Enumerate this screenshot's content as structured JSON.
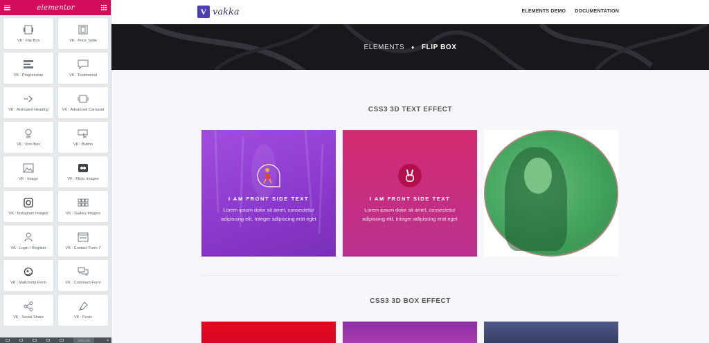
{
  "sidebar": {
    "logo": "elementor",
    "widgets": [
      {
        "label": "VK : Flip Box",
        "icon": "flip-box-icon"
      },
      {
        "label": "VK : Price Table",
        "icon": "price-table-icon"
      },
      {
        "label": "VK : Progressbar",
        "icon": "progressbar-icon"
      },
      {
        "label": "VK : Testimonial",
        "icon": "testimonial-icon"
      },
      {
        "label": "VK : Animated Heading",
        "icon": "animated-heading-icon"
      },
      {
        "label": "VK : Advanced Carousel",
        "icon": "carousel-icon"
      },
      {
        "label": "VK : Icon Box",
        "icon": "icon-box-icon"
      },
      {
        "label": "VK : Button",
        "icon": "button-icon"
      },
      {
        "label": "VK : Image",
        "icon": "image-icon"
      },
      {
        "label": "VK : Flickr Images",
        "icon": "flickr-icon"
      },
      {
        "label": "VK : Instagram Images",
        "icon": "instagram-icon"
      },
      {
        "label": "VK : Gallery Images",
        "icon": "gallery-icon"
      },
      {
        "label": "VK : Login / Register",
        "icon": "login-icon"
      },
      {
        "label": "VK : Contact Form 7",
        "icon": "contact-form-icon"
      },
      {
        "label": "VK : Mailchimp Form",
        "icon": "mailchimp-icon"
      },
      {
        "label": "VK : Comment Form",
        "icon": "comment-form-icon"
      },
      {
        "label": "VK : Social Share",
        "icon": "share-icon"
      },
      {
        "label": "VK : Posts",
        "icon": "posts-icon"
      }
    ],
    "footer": {
      "update_label": "UPDATE"
    }
  },
  "site": {
    "brand": "vakka",
    "brand_mark": "V",
    "nav": [
      "ELEMENTS DEMO",
      "DOCUMENTATION"
    ]
  },
  "banner": {
    "crumb": "ELEMENTS",
    "separator": "♦",
    "current": "FLIP BOX"
  },
  "sections": {
    "text_effect_title": "CSS3 3D TEXT EFFECT",
    "box_effect_title": "CSS3 3D BOX EFFECT"
  },
  "flip_boxes": [
    {
      "title": "I AM FRONT SIDE TEXT",
      "body": "Lorem ipsum dolor sit amet, consectetur adipiscing elit. Integer adipiscing erat eget",
      "icon": "person-illustration-icon"
    },
    {
      "title": "I AM FRONT SIDE TEXT",
      "body": "Lorem ipsum dolor sit amet, consectetur adipiscing elit. Integer adipiscing erat eget",
      "icon": "peace-hand-icon"
    }
  ],
  "colors": {
    "elementor_pink": "#d30c5c",
    "brand_purple": "#4b3fb4",
    "box1": "#9440d6",
    "box2": "#c52c80"
  }
}
